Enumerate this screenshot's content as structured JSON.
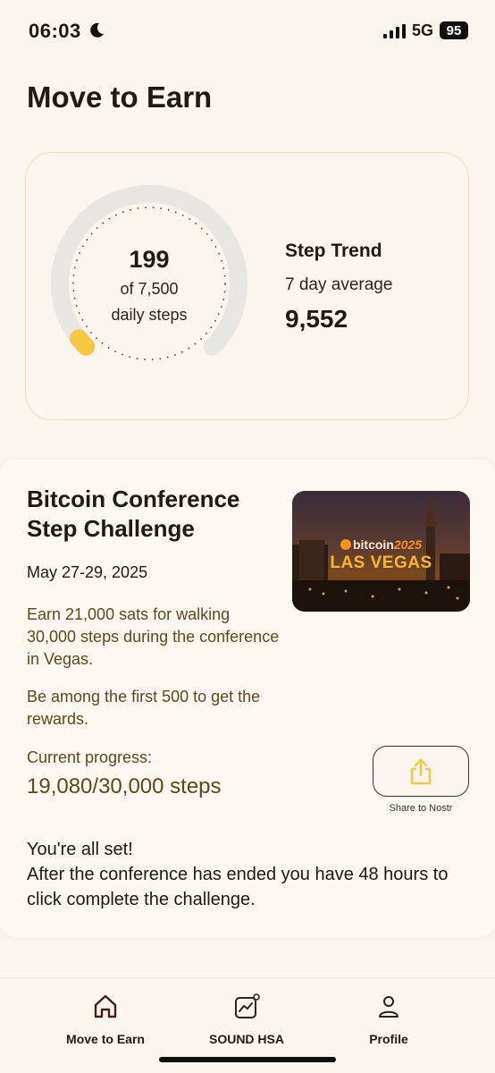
{
  "status_bar": {
    "time": "06:03",
    "network": "5G",
    "battery": "95",
    "icons": [
      "moon-icon",
      "cellular-signal-icon"
    ]
  },
  "page": {
    "title": "Move to Earn"
  },
  "steps_card": {
    "steps_today": "199",
    "goal_text": "of 7,500",
    "goal_caption": "daily steps",
    "daily_goal": 7500,
    "progress_fraction": 0.0265,
    "trend_title": "Step Trend",
    "trend_subtitle": "7 day average",
    "trend_value": "9,552",
    "colors": {
      "ring_track": "#e9e7e3",
      "ring_fill": "#f5c842",
      "card_border": "#f1ddb6"
    }
  },
  "challenge": {
    "title": "Bitcoin Conference Step Challenge",
    "dates": "May 27-29, 2025",
    "description": "Earn 21,000 sats for walking 30,000 steps during the conference in Vegas.",
    "note": "Be among the first 500 to get the rewards.",
    "progress_label": "Current progress:",
    "progress_value": "19,080/30,000 steps",
    "status_line1": "You're all set!",
    "status_line2": "After the conference has ended you have 48 hours to click complete the challenge.",
    "image": {
      "brand_text": "bitcoin",
      "year_text": "2025",
      "location_text": "LAS VEGAS"
    },
    "share_label": "Share to Nostr",
    "colors": {
      "accent_text": "#5b4a18",
      "share_icon": "#f5c842"
    }
  },
  "nav": {
    "items": [
      {
        "label": "Move to Earn",
        "icon": "home-icon",
        "active": true
      },
      {
        "label": "SOUND HSA",
        "icon": "chart-icon",
        "active": false
      },
      {
        "label": "Profile",
        "icon": "person-icon",
        "active": false
      }
    ]
  }
}
